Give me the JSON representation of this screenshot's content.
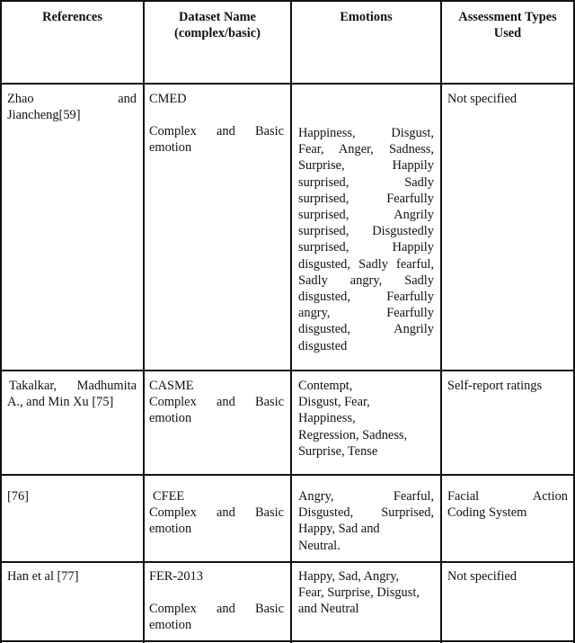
{
  "table": {
    "headers": [
      {
        "lines": [
          "References"
        ]
      },
      {
        "lines": [
          "Dataset Name",
          "(complex/basic)"
        ]
      },
      {
        "lines": [
          "Emotions"
        ]
      },
      {
        "lines": [
          "Assessment Types",
          "Used"
        ]
      }
    ],
    "rows": [
      {
        "reference": [
          "Zhao and",
          "Jiancheng[59]"
        ],
        "dataset_name": "CMED",
        "dataset_type": [
          "Complex and Basic",
          "emotion"
        ],
        "emotions": [
          "Happiness, Disgust,",
          "Fear, Anger, Sadness,",
          "Surprise, Happily",
          "surprised, Sadly",
          "surprised, Fearfully",
          "surprised, Angrily",
          "surprised, Disgustedly",
          "surprised, Happily",
          "disgusted, Sadly fearful,",
          "Sadly angry, Sadly",
          "disgusted, Fearfully",
          "angry, Fearfully",
          "disgusted, Angrily",
          "disgusted"
        ],
        "assessment": [
          "Not specified"
        ]
      },
      {
        "reference": [
          "Takalkar, Madhumita",
          "A., and Min Xu [75]"
        ],
        "dataset_name": "CASME",
        "dataset_type": [
          "Complex and Basic",
          "emotion"
        ],
        "emotions": [
          "Contempt,",
          "Disgust, Fear,",
          "Happiness,",
          "Regression, Sadness,",
          "Surprise, Tense"
        ],
        "assessment": [
          "Self-report ratings"
        ]
      },
      {
        "reference": [
          "[76]"
        ],
        "dataset_name": "CFEE",
        "dataset_type": [
          "Complex and Basic",
          "emotion"
        ],
        "emotions": [
          "Angry, Fearful,",
          "Disgusted, Surprised,",
          "Happy, Sad and",
          "Neutral."
        ],
        "assessment": [
          "Facial Action",
          "Coding System"
        ]
      },
      {
        "reference": [
          "Han et al [77]"
        ],
        "dataset_name": "FER-2013",
        "dataset_type": [
          "Complex and Basic",
          "emotion"
        ],
        "emotions": [
          "Happy, Sad, Angry,",
          "Fear, Surprise, Disgust,",
          "and Neutral"
        ],
        "assessment": [
          "Not specified"
        ]
      }
    ]
  }
}
